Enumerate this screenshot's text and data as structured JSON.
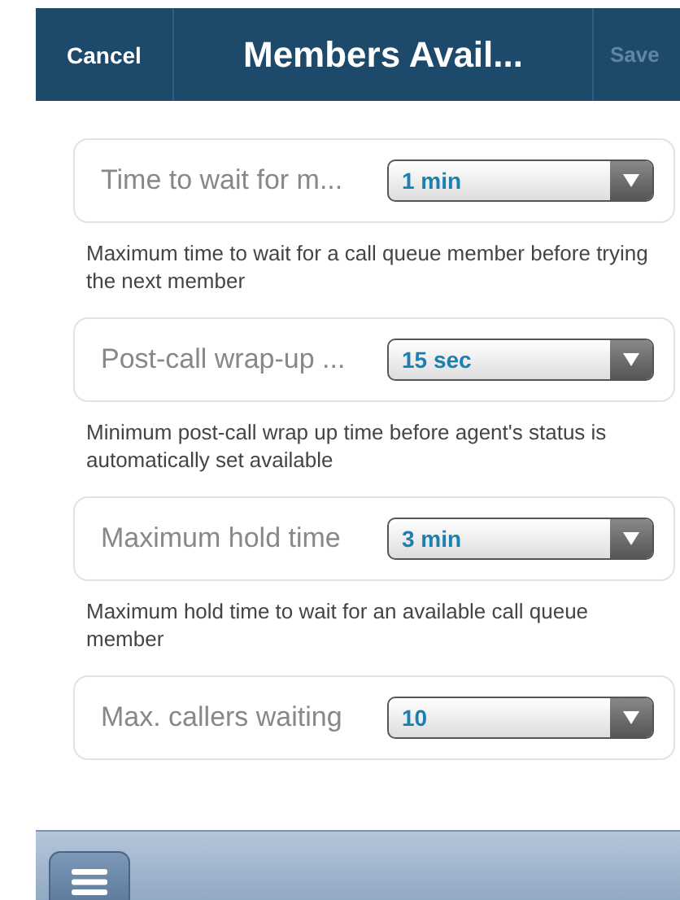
{
  "header": {
    "cancel": "Cancel",
    "title": "Members Avail...",
    "save": {
      "label": "Save",
      "disabled": true
    }
  },
  "settings": [
    {
      "label": "Time to wait for m...",
      "value": "1 min",
      "description": "Maximum time to wait for a call queue member before trying the next member"
    },
    {
      "label": "Post-call wrap-up ...",
      "value": "15 sec",
      "description": "Minimum post-call wrap up time before agent's status is automatically set available"
    },
    {
      "label": "Maximum hold time",
      "value": "3 min",
      "description": "Maximum hold time to wait for an available call queue member"
    },
    {
      "label": "Max. callers waiting",
      "value": "10"
    }
  ]
}
